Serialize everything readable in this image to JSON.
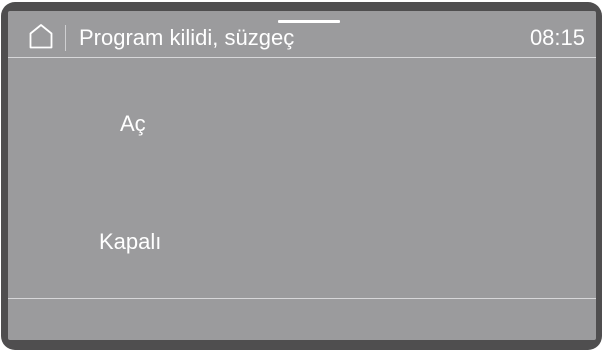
{
  "header": {
    "title": "Program kilidi, süzgeç",
    "time": "08:15",
    "home_icon": "home-icon"
  },
  "options": [
    {
      "label": "Aç"
    },
    {
      "label": "Kapalı"
    }
  ],
  "colors": {
    "bezel": "#4f4e4f",
    "screen": "#9b9b9d",
    "text": "#ffffff",
    "rule": "#d7d7d9"
  }
}
